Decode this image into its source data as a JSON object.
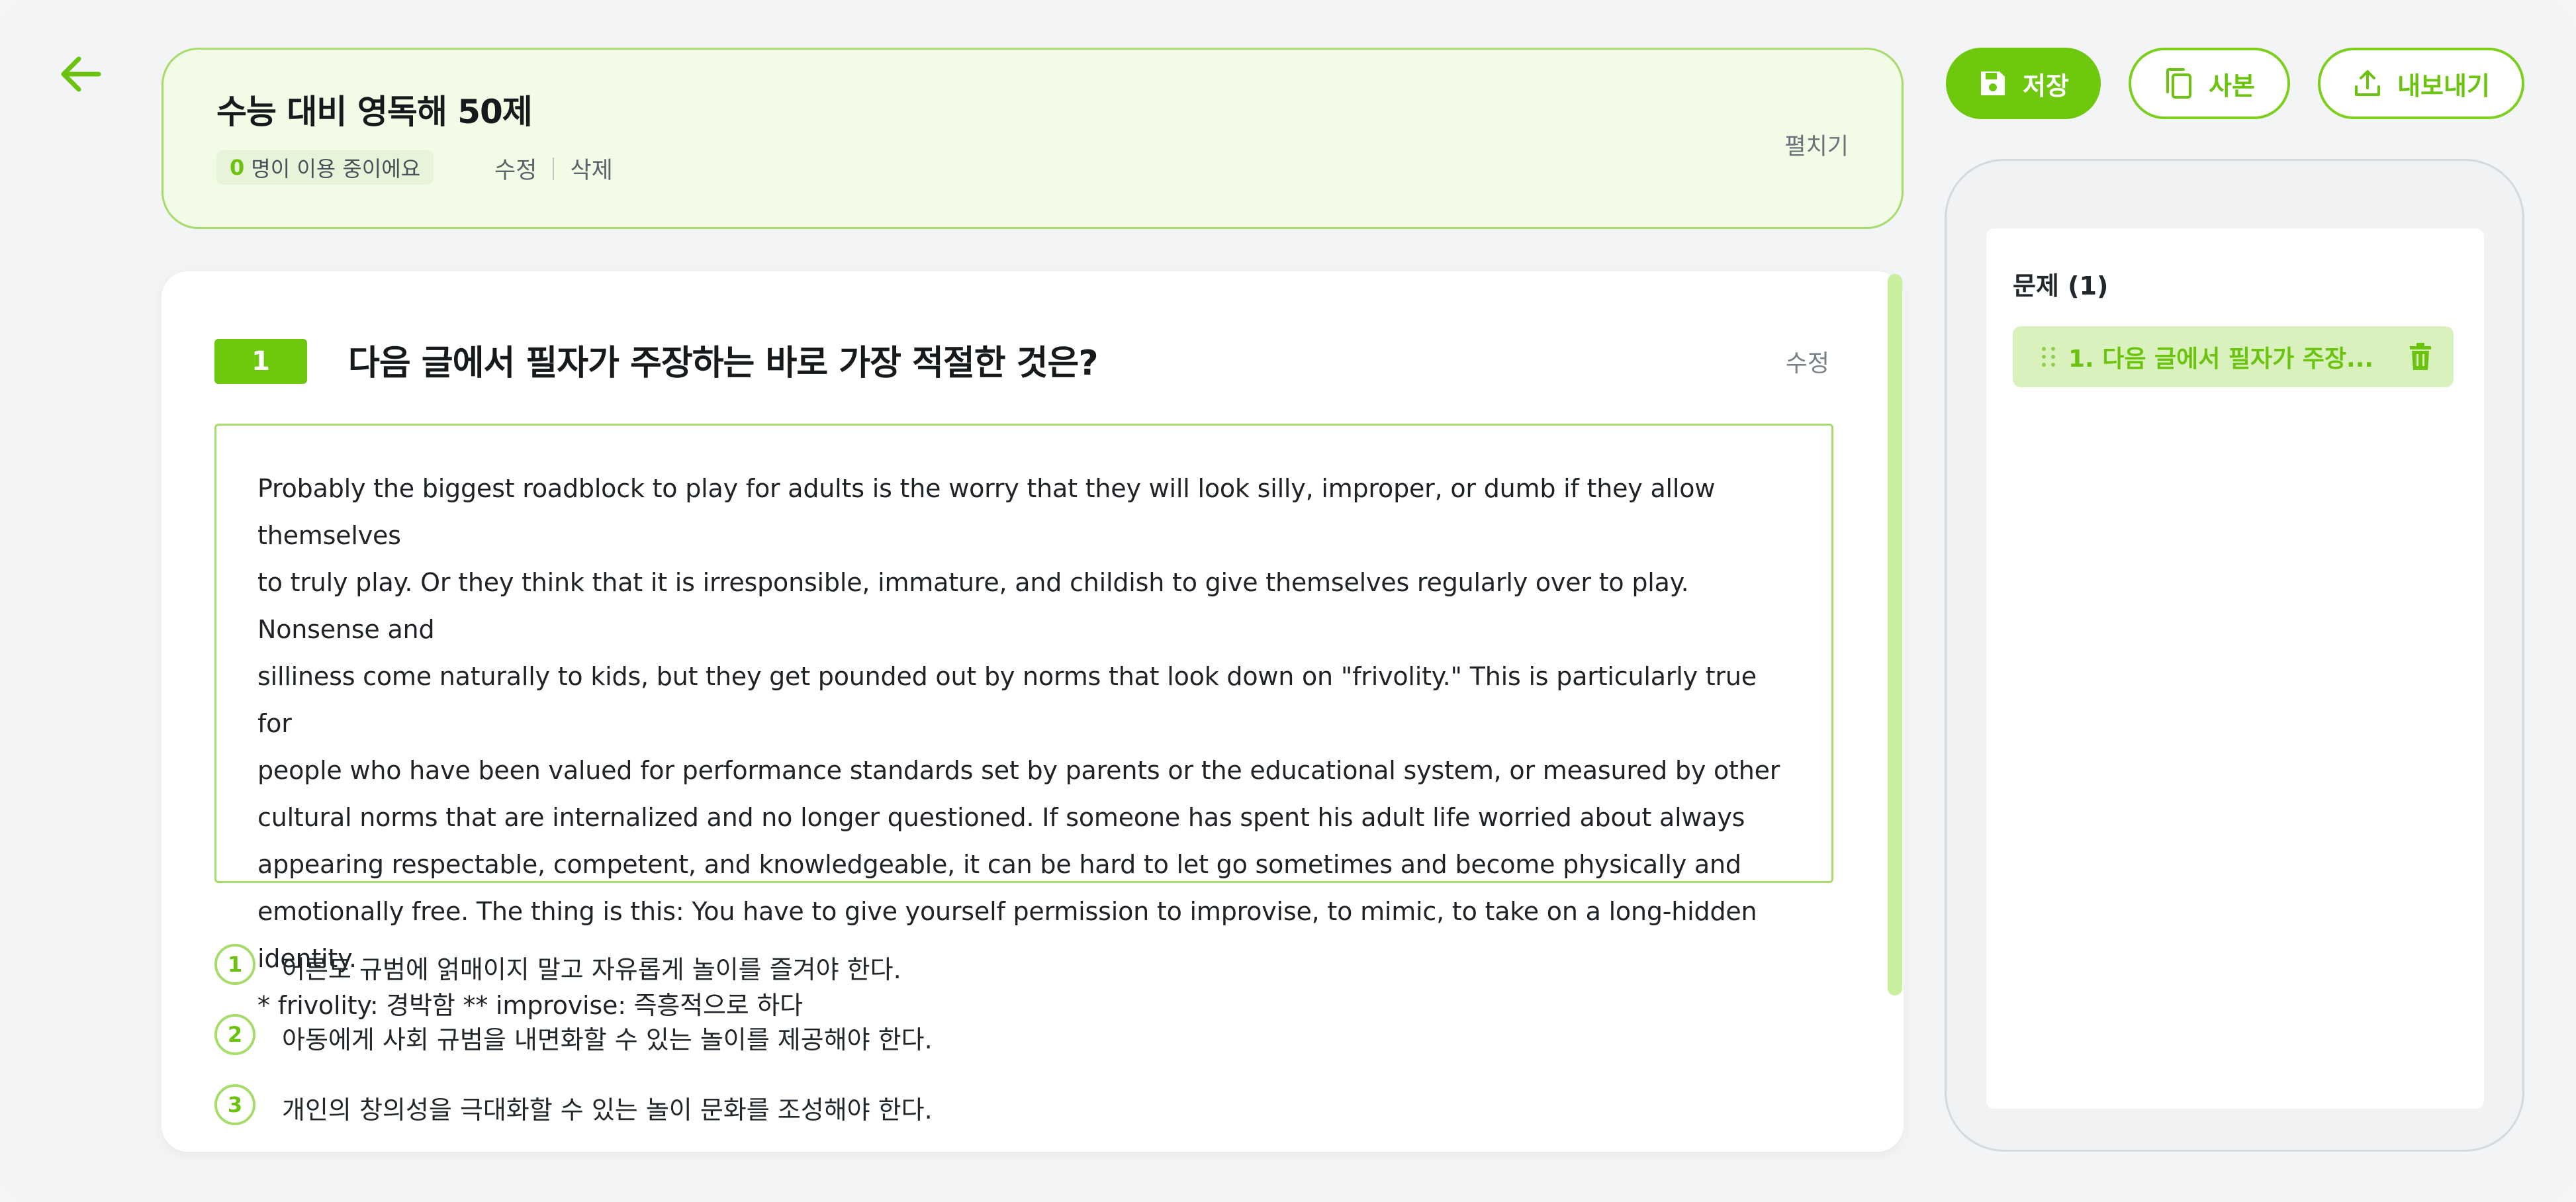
{
  "header": {
    "title": "수능 대비 영독해 50제",
    "user_count": "0",
    "user_suffix": "명이 이용 중이에요",
    "edit_link": "수정",
    "delete_link": "삭제",
    "expand_label": "펼치기"
  },
  "toolbar": {
    "save_label": "저장",
    "copy_label": "사본",
    "export_label": "내보내기"
  },
  "question": {
    "number": "1",
    "text": "다음 글에서 필자가 주장하는 바로 가장 적절한 것은?",
    "edit_label": "수정",
    "passage": "Probably the biggest roadblock to play for adults is the worry that they will look silly, improper, or dumb if they allow themselves\nto truly play. Or they think that it is irresponsible, immature, and childish to give themselves regularly over to play. Nonsense and\nsilliness come naturally to kids, but they get pounded out by norms that look down on \"frivolity.\" This is particularly true for\npeople who have been valued for performance standards set by parents or the educational system, or measured by other\ncultural norms that are internalized and no longer questioned. If someone has spent his adult life worried about always\nappearing respectable, competent, and knowledgeable, it can be hard to let go sometimes and become physically and\nemotionally free. The thing is this: You have to give yourself permission to improvise, to mimic, to take on a long-hidden identity.\n* frivolity: 경박함 ** improvise: 즉흥적으로 하다",
    "options": [
      {
        "num": "1",
        "text": "어른도 규범에 얽매이지 말고 자유롭게 놀이를 즐겨야 한다."
      },
      {
        "num": "2",
        "text": "아동에게 사회 규범을 내면화할 수 있는 놀이를 제공해야 한다."
      },
      {
        "num": "3",
        "text": "개인의 창의성을 극대화할 수 있는 놀이 문화를 조성해야 한다."
      }
    ]
  },
  "sidebar": {
    "title": "문제 (1)",
    "items": [
      {
        "label": "1. 다음 글에서 필자가 주장..."
      }
    ]
  },
  "colors": {
    "accent": "#6dc80e",
    "accent_light": "#f1fbe5",
    "border": "#a6dc6a"
  },
  "icons": [
    "back-arrow-icon",
    "save-disk-icon",
    "copy-icon",
    "upload-icon",
    "drag-handle-icon",
    "trash-icon"
  ]
}
